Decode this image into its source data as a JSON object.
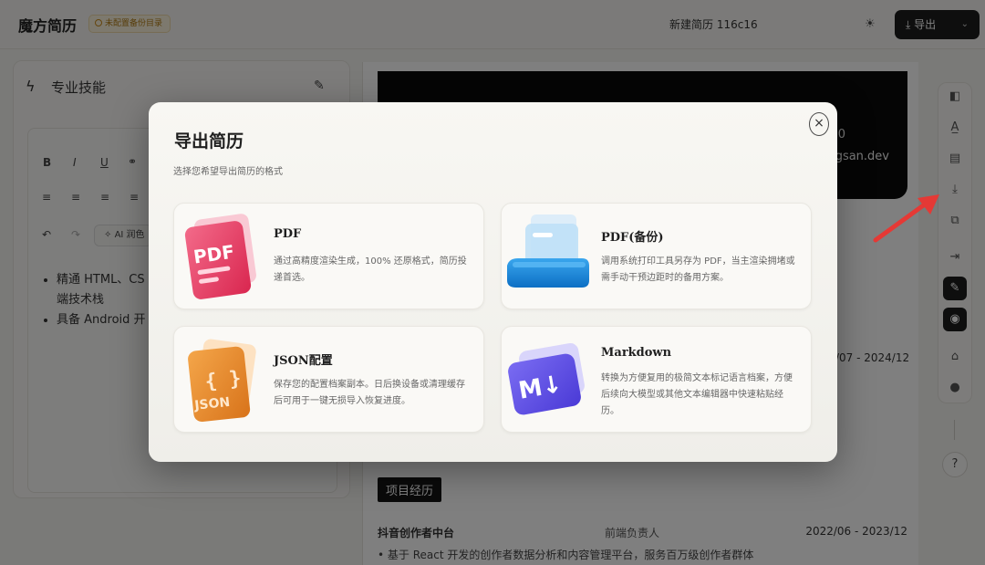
{
  "topbar": {
    "app_title": "魔方简历",
    "cloud_badge": "未配置备份目录",
    "file_name": "新建简历 116c16",
    "export_label": "导出"
  },
  "editor": {
    "section_title": "专业技能",
    "toolbar": {
      "bold": "B",
      "italic": "I",
      "underline": "U",
      "ai_label": "AI 润色"
    },
    "bullets": [
      "精通 HTML、CSS、JavaScript 等前端技术栈",
      "具备 Android 开发经验"
    ],
    "bullet_1_line1": "精通 HTML、CS",
    "bullet_1_line2": "端技术栈",
    "bullet_2": "具备 Android 开"
  },
  "preview": {
    "header_number_fragment": "0",
    "header_email_fragment": "ngsan.dev",
    "experience_date_fragment": "/07 - 2024/12",
    "project_section_label": "项目经历",
    "project": {
      "name": "抖音创作者中台",
      "role": "前端负责人",
      "date": "2022/06 - 2023/12",
      "bullet": "基于 React 开发的创作者数据分析和内容管理平台，服务百万级创作者群体"
    }
  },
  "modal": {
    "title": "导出简历",
    "subtitle": "选择您希望导出简历的格式",
    "options": [
      {
        "title": "PDF",
        "desc": "通过高精度渲染生成，100% 还原格式，简历投递首选。",
        "art_label": "PDF",
        "color": "#e23c63"
      },
      {
        "title": "PDF(备份)",
        "desc": "调用系统打印工具另存为 PDF，当主渲染拥堵或需手动干预边距时的备用方案。",
        "color": "#1e8fe0"
      },
      {
        "title": "JSON配置",
        "desc": "保存您的配置档案副本。日后换设备或清理缓存后可用于一键无损导入恢复进度。",
        "art_label": "JSON",
        "art_symbol": "{ }",
        "color": "#e8872a"
      },
      {
        "title": "Markdown",
        "desc": "转换为方便复用的极简文本标记语言档案，方便后续向大模型或其他文本编辑器中快速粘贴经历。",
        "art_label": "M↓",
        "color": "#5b4ee8"
      }
    ]
  },
  "colors": {
    "accent_dark": "#1d1d1d",
    "arrow": "#e53935",
    "badge_bg": "#fbf3dc"
  }
}
